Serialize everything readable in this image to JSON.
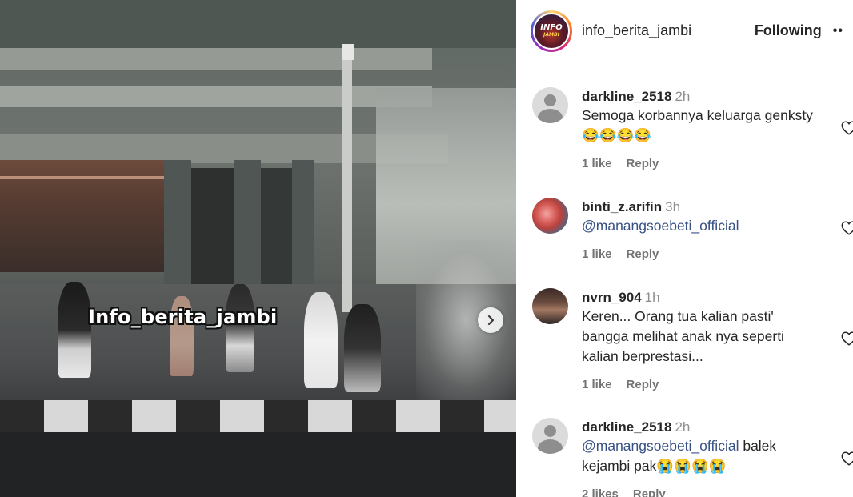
{
  "post": {
    "watermark": "Info_berita_jambi",
    "next_icon": "chevron-right-icon"
  },
  "header": {
    "username": "info_berita_jambi",
    "follow_label": "Following",
    "more_label": "••",
    "avatar_logo_line1": "INFO",
    "avatar_logo_line2": "JAMBI"
  },
  "comments": [
    {
      "username": "darkline_2518",
      "time": "2h",
      "text_parts": [
        "Semoga korbannya keluarga genksty😂😂😂😂"
      ],
      "likes": "1 like",
      "reply": "Reply"
    },
    {
      "username": "binti_z.arifin",
      "time": "3h",
      "mention": "@manangsoebeti_official",
      "likes": "1 like",
      "reply": "Reply"
    },
    {
      "username": "nvrn_904",
      "time": "1h",
      "text_parts": [
        "Keren... Orang tua kalian pasti' bangga melihat anak nya seperti kalian berprestasi..."
      ],
      "likes": "1 like",
      "reply": "Reply"
    },
    {
      "username": "darkline_2518",
      "time": "2h",
      "mention": "@manangsoebeti_official",
      "text_after": " balek kejambi pak😭😭😭😭",
      "likes": "2 likes",
      "reply": "Reply"
    }
  ],
  "colors": {
    "mention": "#385185",
    "muted": "#737373",
    "text": "#262626"
  }
}
